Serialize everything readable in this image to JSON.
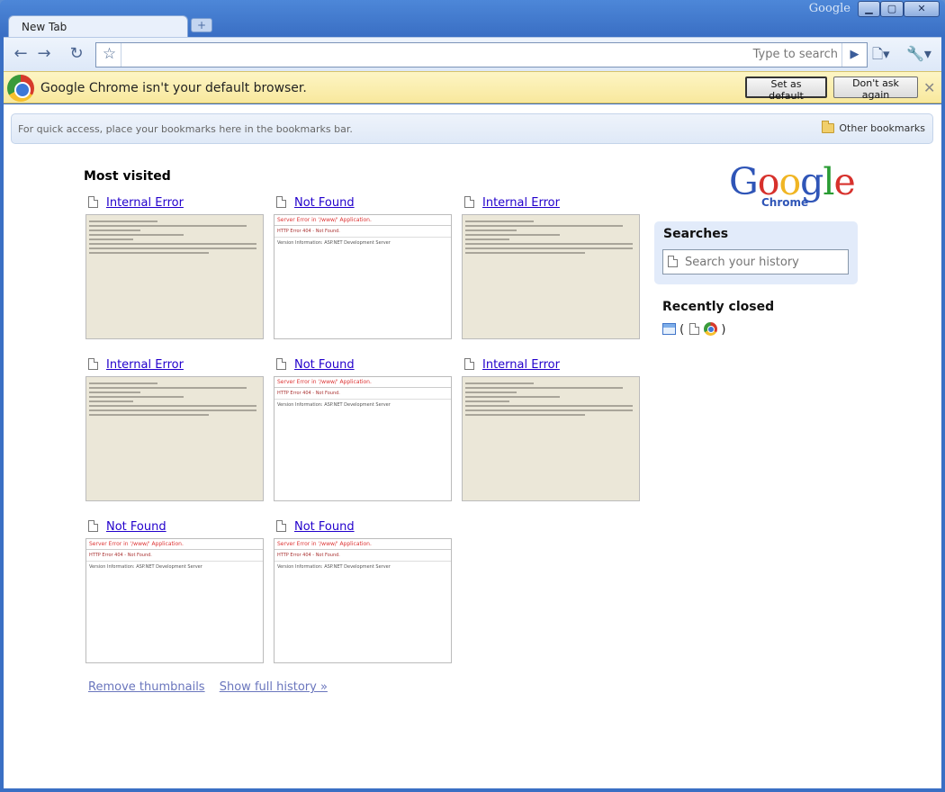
{
  "window": {
    "brand": "Google",
    "min": "▁",
    "max": "▢",
    "close": "✕"
  },
  "tabs": [
    {
      "label": "New Tab"
    }
  ],
  "toolbar": {
    "omnibox_value": "",
    "type_to_search": "Type to search",
    "icons": [
      "back-icon",
      "forward-icon",
      "reload-icon",
      "star-icon",
      "go-icon",
      "page-menu-icon",
      "wrench-icon"
    ]
  },
  "infobar": {
    "message": "Google Chrome isn't your default browser.",
    "set_default": "Set as default",
    "dont_ask": "Don't ask again"
  },
  "bookmarks_bar": {
    "hint": "For quick access, place your bookmarks here in the bookmarks bar.",
    "other": "Other bookmarks"
  },
  "most_visited": {
    "title": "Most visited",
    "tiles": [
      {
        "label": "Internal Error",
        "kind": "err"
      },
      {
        "label": "Not Found",
        "kind": "nf"
      },
      {
        "label": "Internal Error",
        "kind": "err"
      },
      {
        "label": "Internal Error",
        "kind": "err"
      },
      {
        "label": "Not Found",
        "kind": "nf"
      },
      {
        "label": "Internal Error",
        "kind": "err"
      },
      {
        "label": "Not Found",
        "kind": "nf"
      },
      {
        "label": "Not Found",
        "kind": "nf"
      }
    ],
    "thumb_nf_heading": "Server Error in '/www/' Application.",
    "thumb_nf_line": "HTTP Error 404 - Not Found.",
    "thumb_nf_line2": "Version Information: ASP.NET Development Server"
  },
  "links": {
    "remove_thumbnails": "Remove thumbnails",
    "show_history": "Show full history »"
  },
  "sidebar": {
    "logo_chrome": "Chrome",
    "searches_title": "Searches",
    "search_placeholder": "Search your history",
    "recently_closed": "Recently closed",
    "rc_open": "(",
    "rc_close": ")"
  },
  "colors": {
    "accent": "#3a6fc4",
    "link": "#2200cc",
    "infobar": "#fbeeb0"
  }
}
